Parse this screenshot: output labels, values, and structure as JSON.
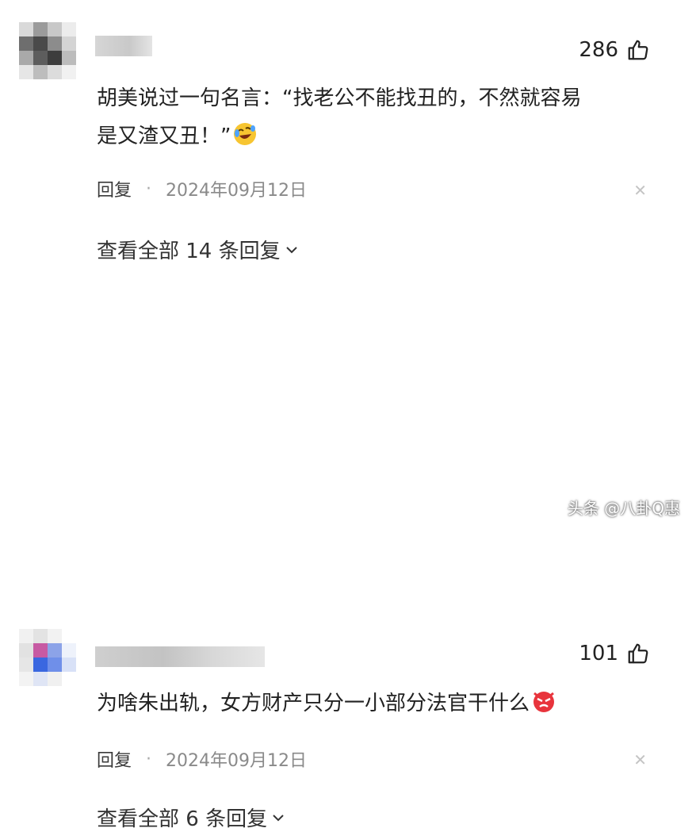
{
  "comments": [
    {
      "likes": "286",
      "text_line1": "胡美说过一句名言：“找老公不能找丑的，不然就容易",
      "text_line2": "是又渣又丑！”",
      "emoji": "crying-laughing-emoji",
      "reply_label": "回复",
      "separator": "·",
      "date": "2024年09月12日",
      "view_replies": "查看全部 14 条回复"
    },
    {
      "likes": "101",
      "text_line1": "为啥朱出轨，女方财产只分一小部分法官干什么",
      "emoji": "angry-face-emoji",
      "reply_label": "回复",
      "separator": "·",
      "date": "2024年09月12日",
      "view_replies": "查看全部 6 条回复"
    }
  ],
  "close_icon": "✕",
  "watermark": "头条 @八卦Q惠",
  "colors": {
    "text": "#222222",
    "meta": "#8a8a8a",
    "emoji_angry": "#e8343c",
    "emoji_laugh": "#f7c531"
  }
}
